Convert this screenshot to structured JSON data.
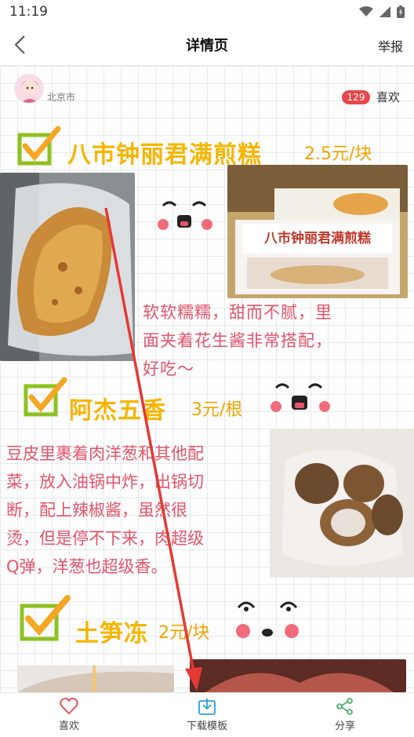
{
  "status_bar": {
    "time": "11:19"
  },
  "nav": {
    "title": "详情页",
    "report_label": "举报"
  },
  "user": {
    "city": "北京市",
    "like_count": "129",
    "like_label": "喜欢"
  },
  "sections": [
    {
      "title": "八市钟丽君满煎糕",
      "price": "2.5元/块",
      "description_lines": [
        "软软糯糯，甜而不腻，里",
        "面夹着花生酱非常搭配，",
        "好吃～"
      ],
      "shop_sign": "八市钟丽君满煎糕"
    },
    {
      "title": "阿杰五香",
      "price": "3元/根",
      "description_lines": [
        "豆皮里裹着肉洋葱和其他配",
        "菜，放入油锅中炸，出锅切",
        "断，配上辣椒酱，虽然很",
        "烫，但是停不下来，肉超级",
        "Q弹，洋葱也超级香。"
      ]
    },
    {
      "title": "土笋冻",
      "price": "2元/块"
    }
  ],
  "bottom_bar": {
    "like_label": "喜欢",
    "download_label": "下载模板",
    "share_label": "分享"
  },
  "colors": {
    "accent_red": "#e8474a",
    "title_yellow": "#f7b500",
    "desc_pink": "#e2546a",
    "check_green": "#8dc21f"
  }
}
